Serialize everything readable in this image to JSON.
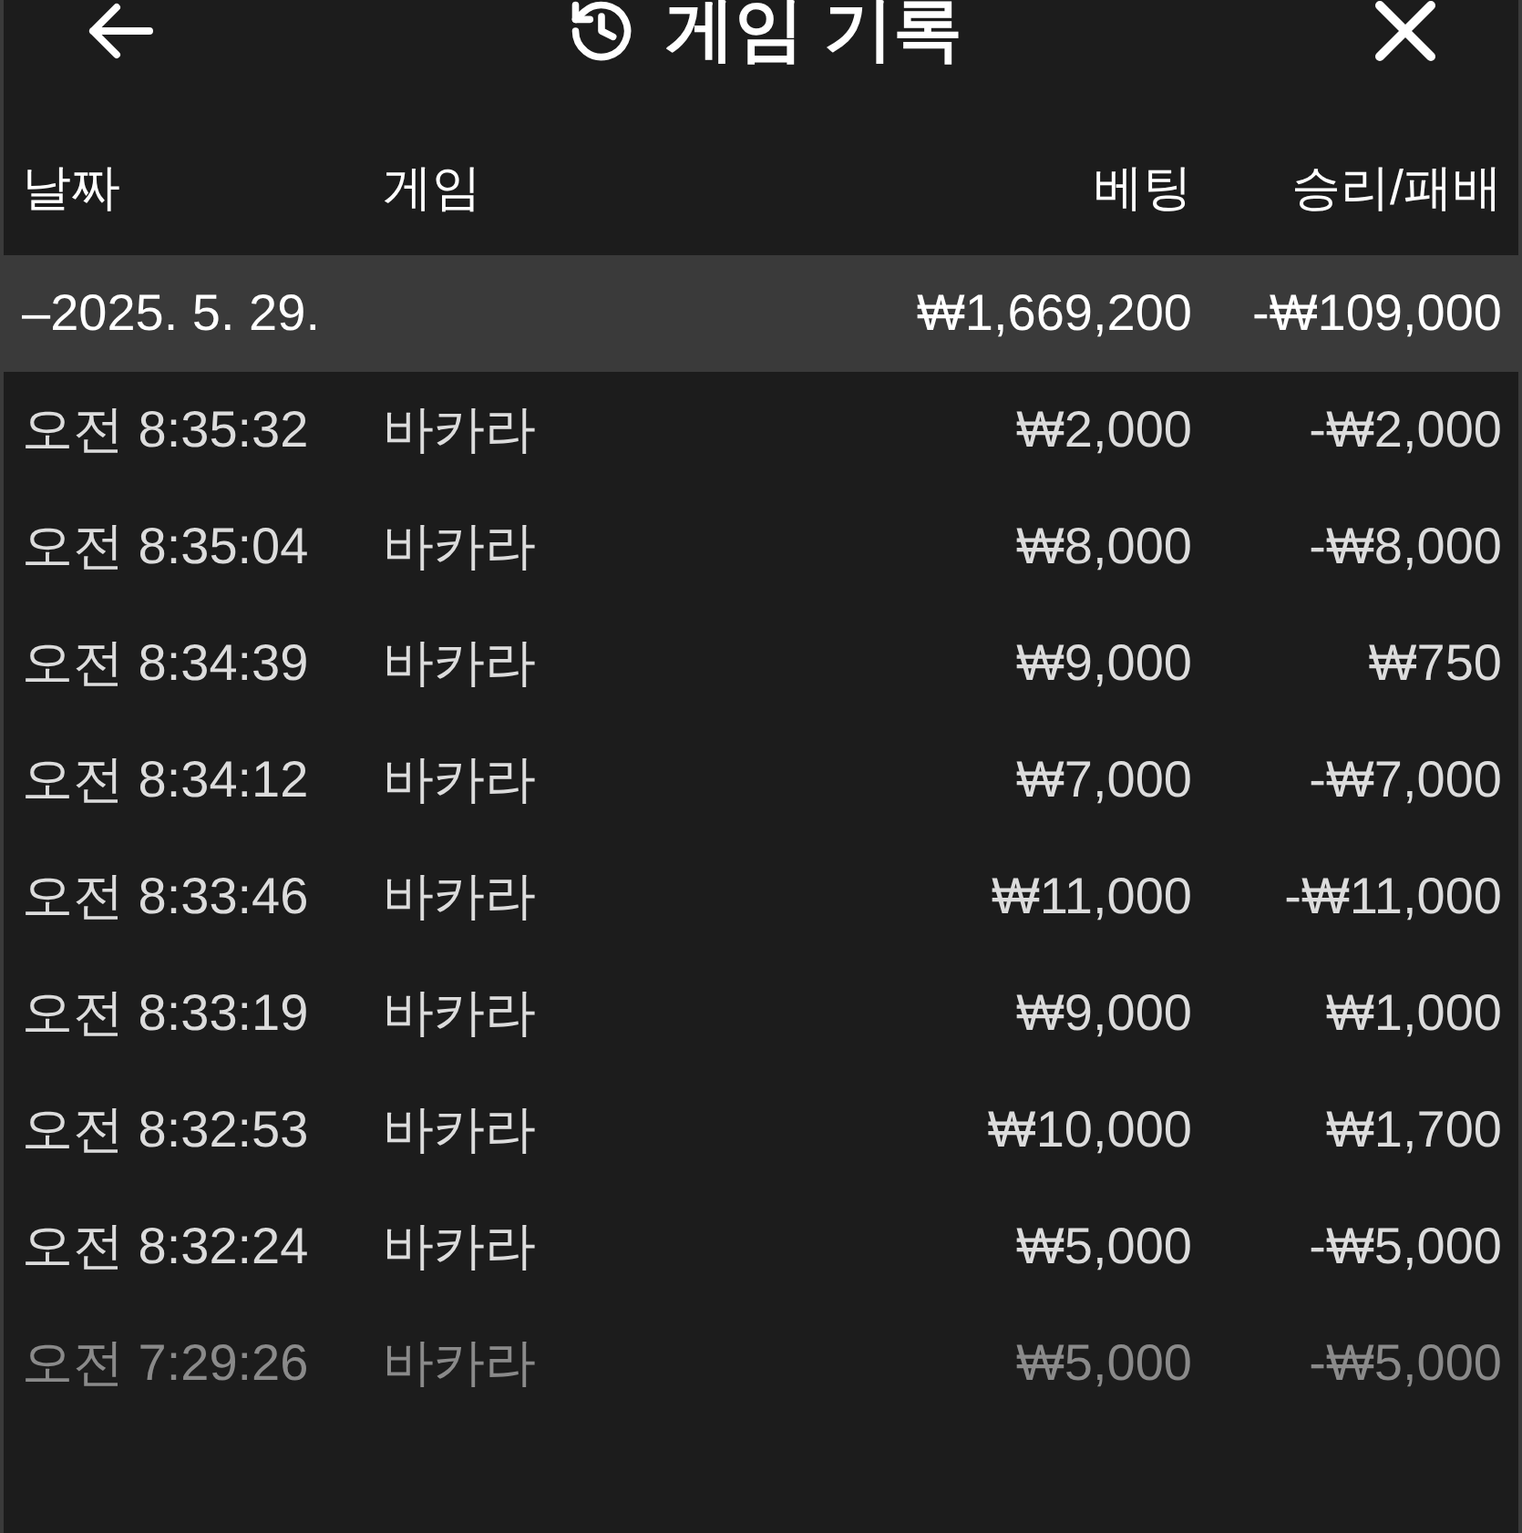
{
  "header": {
    "title": "게임 기록"
  },
  "columns": [
    "날짜",
    "게임",
    "베팅",
    "승리/패배"
  ],
  "group": {
    "date": "–2025. 5. 29.",
    "bet": "₩1,669,200",
    "result": "-₩109,000"
  },
  "rows": [
    {
      "time": "오전 8:35:32",
      "game": "바카라",
      "bet": "₩2,000",
      "result": "-₩2,000",
      "faded": false
    },
    {
      "time": "오전 8:35:04",
      "game": "바카라",
      "bet": "₩8,000",
      "result": "-₩8,000",
      "faded": false
    },
    {
      "time": "오전 8:34:39",
      "game": "바카라",
      "bet": "₩9,000",
      "result": "₩750",
      "faded": false
    },
    {
      "time": "오전 8:34:12",
      "game": "바카라",
      "bet": "₩7,000",
      "result": "-₩7,000",
      "faded": false
    },
    {
      "time": "오전 8:33:46",
      "game": "바카라",
      "bet": "₩11,000",
      "result": "-₩11,000",
      "faded": false
    },
    {
      "time": "오전 8:33:19",
      "game": "바카라",
      "bet": "₩9,000",
      "result": "₩1,000",
      "faded": false
    },
    {
      "time": "오전 8:32:53",
      "game": "바카라",
      "bet": "₩10,000",
      "result": "₩1,700",
      "faded": false
    },
    {
      "time": "오전 8:32:24",
      "game": "바카라",
      "bet": "₩5,000",
      "result": "-₩5,000",
      "faded": false
    },
    {
      "time": "오전 7:29:26",
      "game": "바카라",
      "bet": "₩5,000",
      "result": "-₩5,000",
      "faded": true
    }
  ]
}
